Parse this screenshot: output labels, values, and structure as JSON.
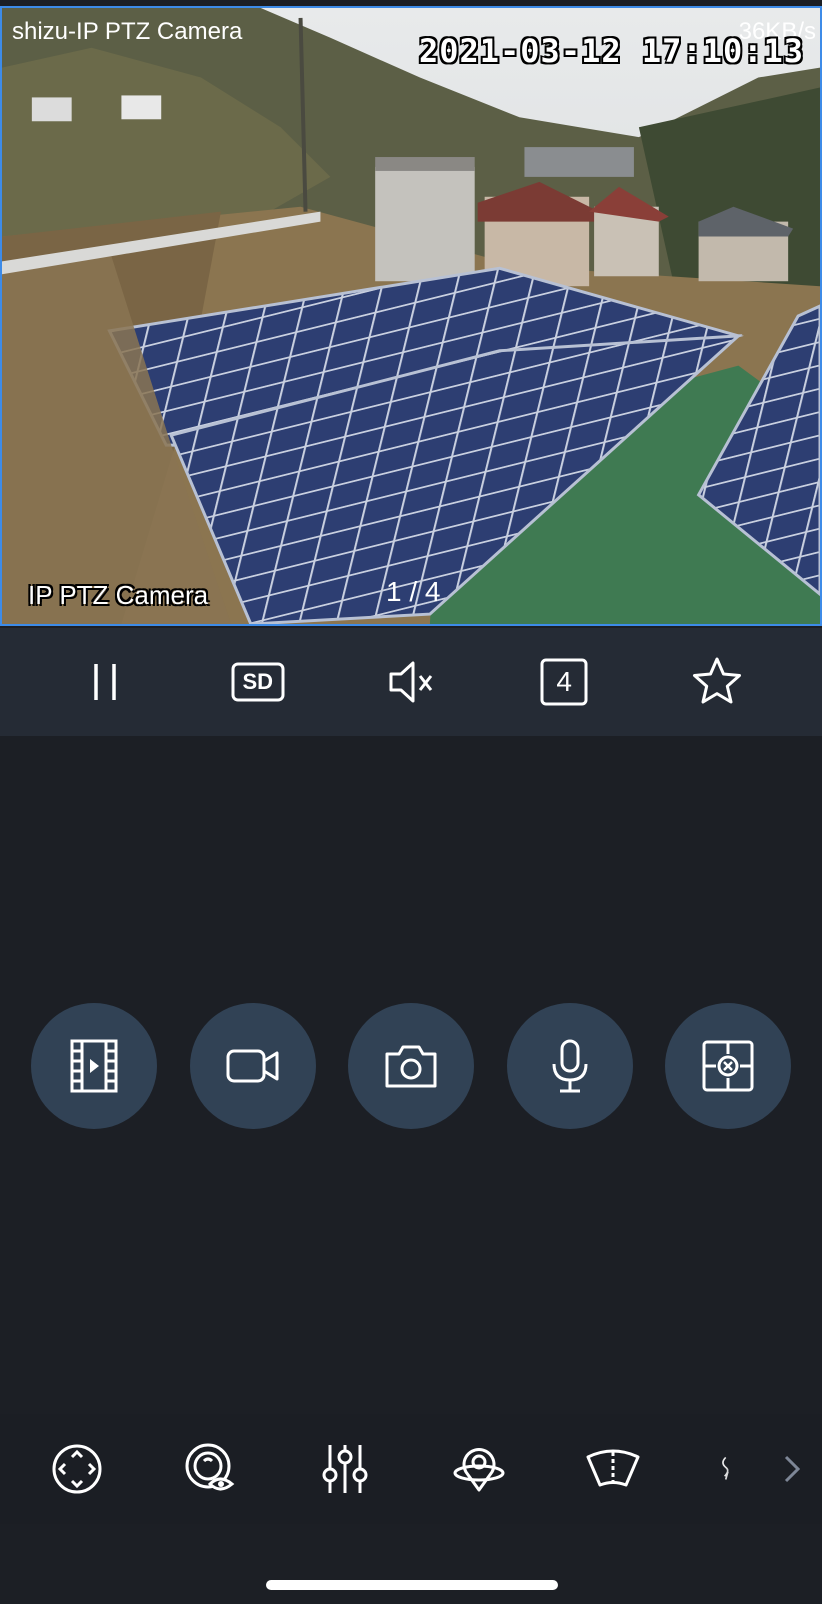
{
  "video": {
    "camera_title": "shizu-IP PTZ Camera",
    "bitrate": "36KB/s",
    "timestamp": "2021-03-12 17:10:13",
    "osd_name": "IP PTZ Camera",
    "page_indicator": "1 / 4"
  },
  "controls": {
    "pause_icon": "pause-icon",
    "quality_label": "SD",
    "mute_icon": "speaker-muted-icon",
    "split_label": "4",
    "favorite_icon": "star-icon"
  },
  "actions": [
    {
      "icon": "video-playback-icon"
    },
    {
      "icon": "record-video-icon"
    },
    {
      "icon": "camera-snapshot-icon"
    },
    {
      "icon": "microphone-icon"
    },
    {
      "icon": "close-target-icon"
    }
  ],
  "ptz": [
    {
      "icon": "ptz-direction-icon"
    },
    {
      "icon": "lens-view-icon"
    },
    {
      "icon": "adjust-sliders-icon"
    },
    {
      "icon": "preset-location-icon"
    },
    {
      "icon": "wide-angle-icon"
    },
    {
      "icon": "cruise-icon"
    }
  ],
  "colors": {
    "background": "#1c1f25",
    "control_bar": "#252b35",
    "action_circle": "#314255",
    "video_border": "#3d8be8"
  }
}
